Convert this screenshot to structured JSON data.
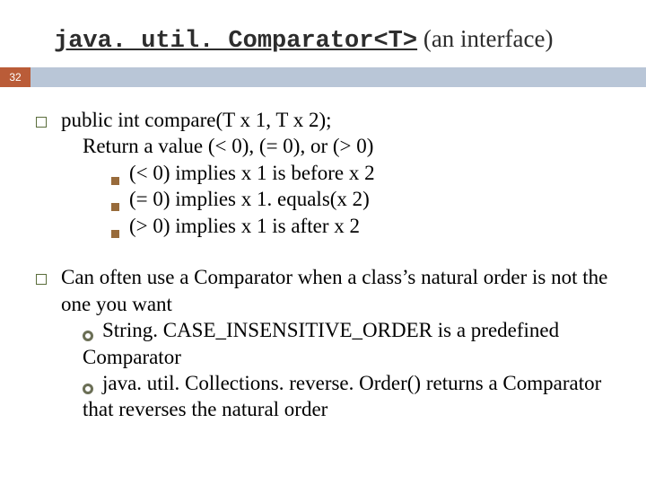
{
  "page_number": "32",
  "title": {
    "code": "java. util. Comparator<T>",
    "rest": " (an interface)"
  },
  "body": {
    "p1": {
      "line1": "public int compare(T x 1, T x 2);",
      "line2": "Return a value (< 0), (= 0), or (> 0)",
      "sub": {
        "a": "(< 0) implies x 1 is before x 2",
        "b": "(= 0) implies x 1. equals(x 2)",
        "c": "(> 0) implies x 1 is after x 2"
      }
    },
    "p2": {
      "line1": "Can often use a Comparator when a class’s natural order is not the one you want",
      "sub": {
        "a_lead": "String. CASE_INSENSITIVE_ORDER is a predefined",
        "a_cont": "Comparator",
        "b_lead": "java. util. Collections. reverse. Order() returns a Comparator",
        "b_cont": "that reverses the natural order"
      }
    }
  }
}
